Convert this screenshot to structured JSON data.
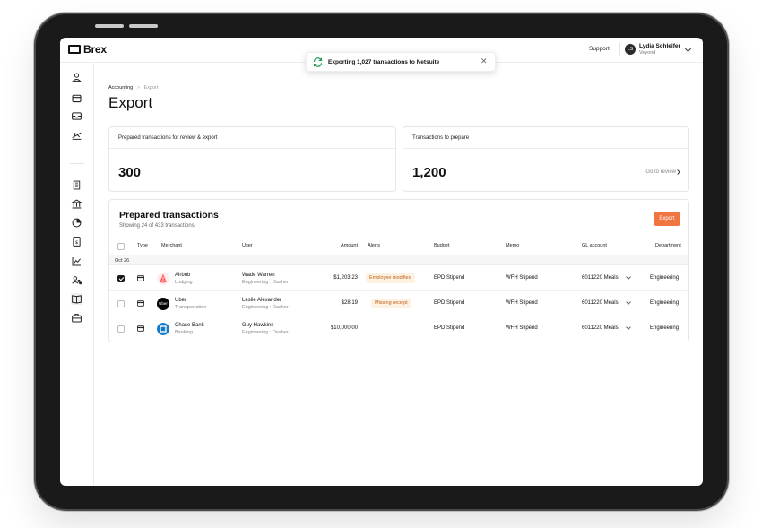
{
  "app": {
    "brand": "Brex",
    "support_label": "Support",
    "user": {
      "initials": "LS",
      "name": "Lydia Schleifer",
      "org": "Veyond"
    }
  },
  "toast": {
    "message": "Exporting 1,027 transactions to Netsuite",
    "close": "✕"
  },
  "breadcrumb": {
    "root": "Accounting",
    "separator": ">",
    "current": "Export"
  },
  "page": {
    "title": "Export"
  },
  "summary": {
    "prepared": {
      "label": "Prepared transactions for review & export",
      "value": "300"
    },
    "to_prepare": {
      "label": "Transactions to prepare",
      "value": "1,200",
      "link": "Go to review"
    }
  },
  "table": {
    "title": "Prepared transactions",
    "subtitle": "Showing 24 of 433 transactions",
    "export_label": "Export",
    "columns": {
      "type": "Type",
      "merchant": "Merchant",
      "user": "User",
      "amount": "Amount",
      "alerts": "Alerts",
      "budget": "Budget",
      "memo": "Memo",
      "gl": "GL account",
      "department": "Department"
    },
    "date_group": "Oct 26",
    "rows": [
      {
        "checked": true,
        "merchant": "Airbnb",
        "category": "Lodging",
        "user": "Wade Warren",
        "team": "Engineering : Dasher",
        "amount": "$1,203.23",
        "alert": "Employee modified",
        "budget": "EPD Stipend",
        "memo": "WFH Stipend",
        "gl": "6011220 Meals",
        "department": "Engineering"
      },
      {
        "checked": false,
        "merchant": "Uber",
        "category": "Transportation",
        "user": "Leslie Alexander",
        "team": "Engineering : Dasher",
        "amount": "$28.19",
        "alert": "Missing receipt",
        "budget": "EPD Stipend",
        "memo": "WFH Stipend",
        "gl": "6011220 Meals",
        "department": "Engineering"
      },
      {
        "checked": false,
        "merchant": "Chase Bank",
        "category": "Banking",
        "user": "Guy Hawkins",
        "team": "Engineering : Dasher",
        "amount": "$10,000.00",
        "alert": "",
        "budget": "EPD Stipend",
        "memo": "WFH Stipend",
        "gl": "6011220 Meals",
        "department": "Engineering"
      }
    ],
    "logo_text": {
      "uber": "Uber"
    }
  },
  "colors": {
    "accent": "#f07543",
    "alert_bg": "#fdf1e2",
    "alert_text": "#c2611b",
    "airbnb": "#ff5a5f",
    "chase": "#117aca"
  },
  "icons": {
    "nav": [
      "user-icon",
      "wallet-icon",
      "inbox-icon",
      "travel-icon",
      "building-icon",
      "bank-icon",
      "pie-chart-icon",
      "receipt-icon",
      "line-chart-icon",
      "team-icon",
      "book-icon",
      "briefcase-icon"
    ]
  }
}
